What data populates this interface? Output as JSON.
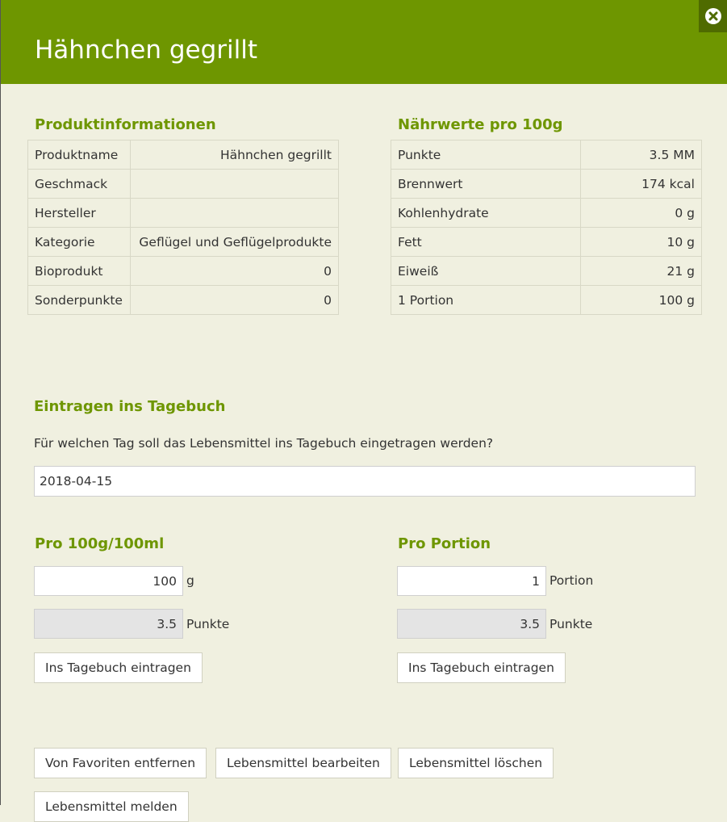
{
  "header": {
    "title": "Hähnchen gegrillt"
  },
  "product_info": {
    "heading": "Produktinformationen",
    "rows": [
      {
        "label": "Produktname",
        "value": "Hähnchen gegrillt"
      },
      {
        "label": "Geschmack",
        "value": ""
      },
      {
        "label": "Hersteller",
        "value": ""
      },
      {
        "label": "Kategorie",
        "value": "Geflügel und Geflügelprodukte"
      },
      {
        "label": "Bioprodukt",
        "value": "0"
      },
      {
        "label": "Sonderpunkte",
        "value": "0"
      }
    ]
  },
  "nutrition": {
    "heading": "Nährwerte pro 100g",
    "rows": [
      {
        "label": "Punkte",
        "value": "3.5 MM"
      },
      {
        "label": "Brennwert",
        "value": "174 kcal"
      },
      {
        "label": "Kohlenhydrate",
        "value": "0 g"
      },
      {
        "label": "Fett",
        "value": "10 g"
      },
      {
        "label": "Eiweiß",
        "value": "21 g"
      },
      {
        "label": "1 Portion",
        "value": "100 g"
      }
    ]
  },
  "diary": {
    "heading": "Eintragen ins Tagebuch",
    "prompt": "Für welchen Tag soll das Lebensmittel ins Tagebuch eingetragen werden?",
    "date": "2018-04-15"
  },
  "per100": {
    "heading": "Pro 100g/100ml",
    "amount": "100",
    "amount_unit": "g",
    "points": "3.5",
    "points_unit": "Punkte",
    "button": "Ins Tagebuch eintragen"
  },
  "perPortion": {
    "heading": "Pro Portion",
    "amount": "1",
    "amount_unit": "Portion",
    "points": "3.5",
    "points_unit": "Punkte",
    "button": "Ins Tagebuch eintragen"
  },
  "actions": {
    "remove_favorite": "Von Favoriten entfernen",
    "edit": "Lebensmittel bearbeiten",
    "delete": "Lebensmittel löschen",
    "report": "Lebensmittel melden"
  },
  "colors": {
    "header": "#6e9600",
    "accent": "#6e9600",
    "background": "#f0f0e0",
    "close_bg": "#4f6b00"
  },
  "icons": {
    "close": "close-circle-icon"
  }
}
